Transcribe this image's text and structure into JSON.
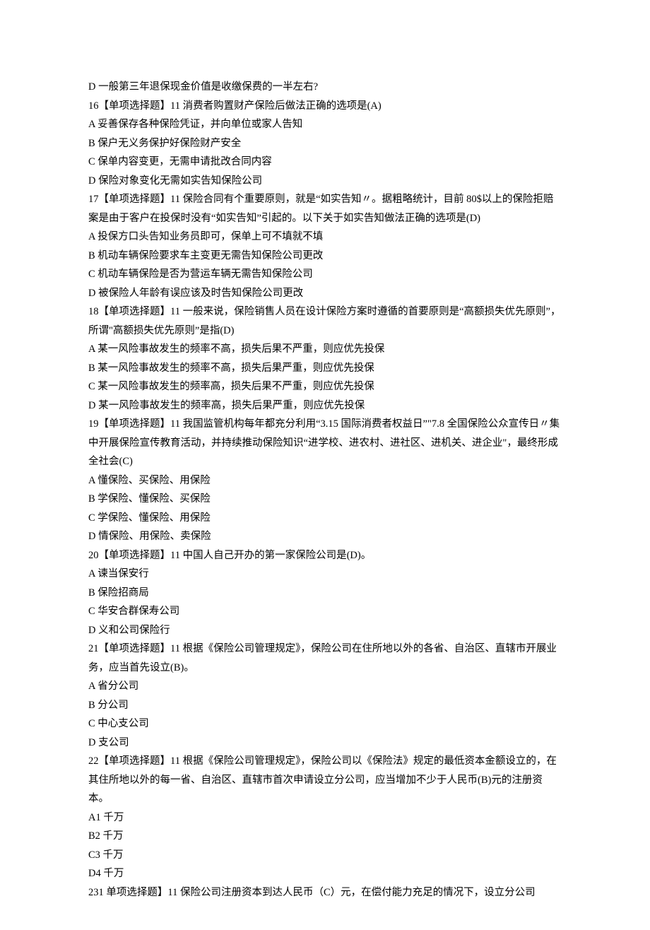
{
  "lines": [
    "D 一般第三年退保现金价值是收缴保费的一半左右?",
    "16【单项选择题】11 消费者购置财产保险后做法正确的选项是(A)",
    "A 妥善保存各种保险凭证，并向单位或家人告知",
    "B 保户无义务保护好保险财产安全",
    "C 保单内容变更，无需申请批改合同内容",
    "D 保险对象变化无需如实告知保险公司",
    "17【单项选择题】11 保险合同有个重要原则，就是“如实告知〃。据粗略统计，目前 80$以上的保险拒赔案是由于客户在投保时没有“如实告知”引起的。以下关于如实告知做法正确的选项是(D)",
    "A 投保方口头告知业务员即可，保单上可不填就不填",
    "B 机动车辆保险要求车主变更无需告知保险公司更改",
    "C 机动车辆保险是否为营运车辆无需告知保险公司",
    "D 被保险人年龄有误应该及时告知保险公司更改",
    "18【单项选择题】11 一般来说，保险销售人员在设计保险方案时遵循的首要原则是“高额损失优先原则”，所谓\"高额损失优先原则”是指(D)",
    "A 某一风险事故发生的频率不高，损失后果不严重，则应优先投保",
    "B 某一风险事故发生的频率不高，损失后果严重，则应优先投保",
    "C 某一风险事故发生的频率高，损失后果不严重，则应优先投保",
    "D 某一风险事故发生的频率高，损失后果严重，则应优先投保",
    "19【单项选择题】11 我国监管机构每年都充分利用“3.15 国际消费者权益日”\"7.8 全国保险公众宣传日〃集中开展保险宣传教育活动，并持续推动保险知识“进学校、进农村、进社区、进机关、进企业\"，最终形成全社会(C)",
    "A 懂保险、买保险、用保险",
    "B 学保险、懂保险、买保险",
    "C 学保险、懂保险、用保险",
    "D 情保险、用保险、卖保险",
    "20【单项选择题】11 中国人自己开办的第一家保险公司是(D)。",
    "A 谏当保安行",
    "B 保险招商局",
    "C 华安合群保寿公司",
    "D 义和公司保险行",
    "21【单项选择题】11 根据《保险公司管理规定》，保险公司在住所地以外的各省、自治区、直辖市开展业务，应当首先设立(B)。",
    "A 省分公司",
    "B 分公司",
    "C 中心支公司",
    "D 支公司",
    "22【单项选择题】11 根据《保险公司管理规定》，保险公司以《保险法》规定的最低资本金额设立的，在其住所地以外的每一省、自治区、直辖市首次申请设立分公司，应当增加不少于人民币(B)元的注册资本。",
    "A1 千万",
    "B2 千万",
    "C3 千万",
    "D4 千万",
    "231 单项选择题】11 保险公司注册资本到达人民币（C）元，在偿付能力充足的情况下，设立分公司"
  ]
}
